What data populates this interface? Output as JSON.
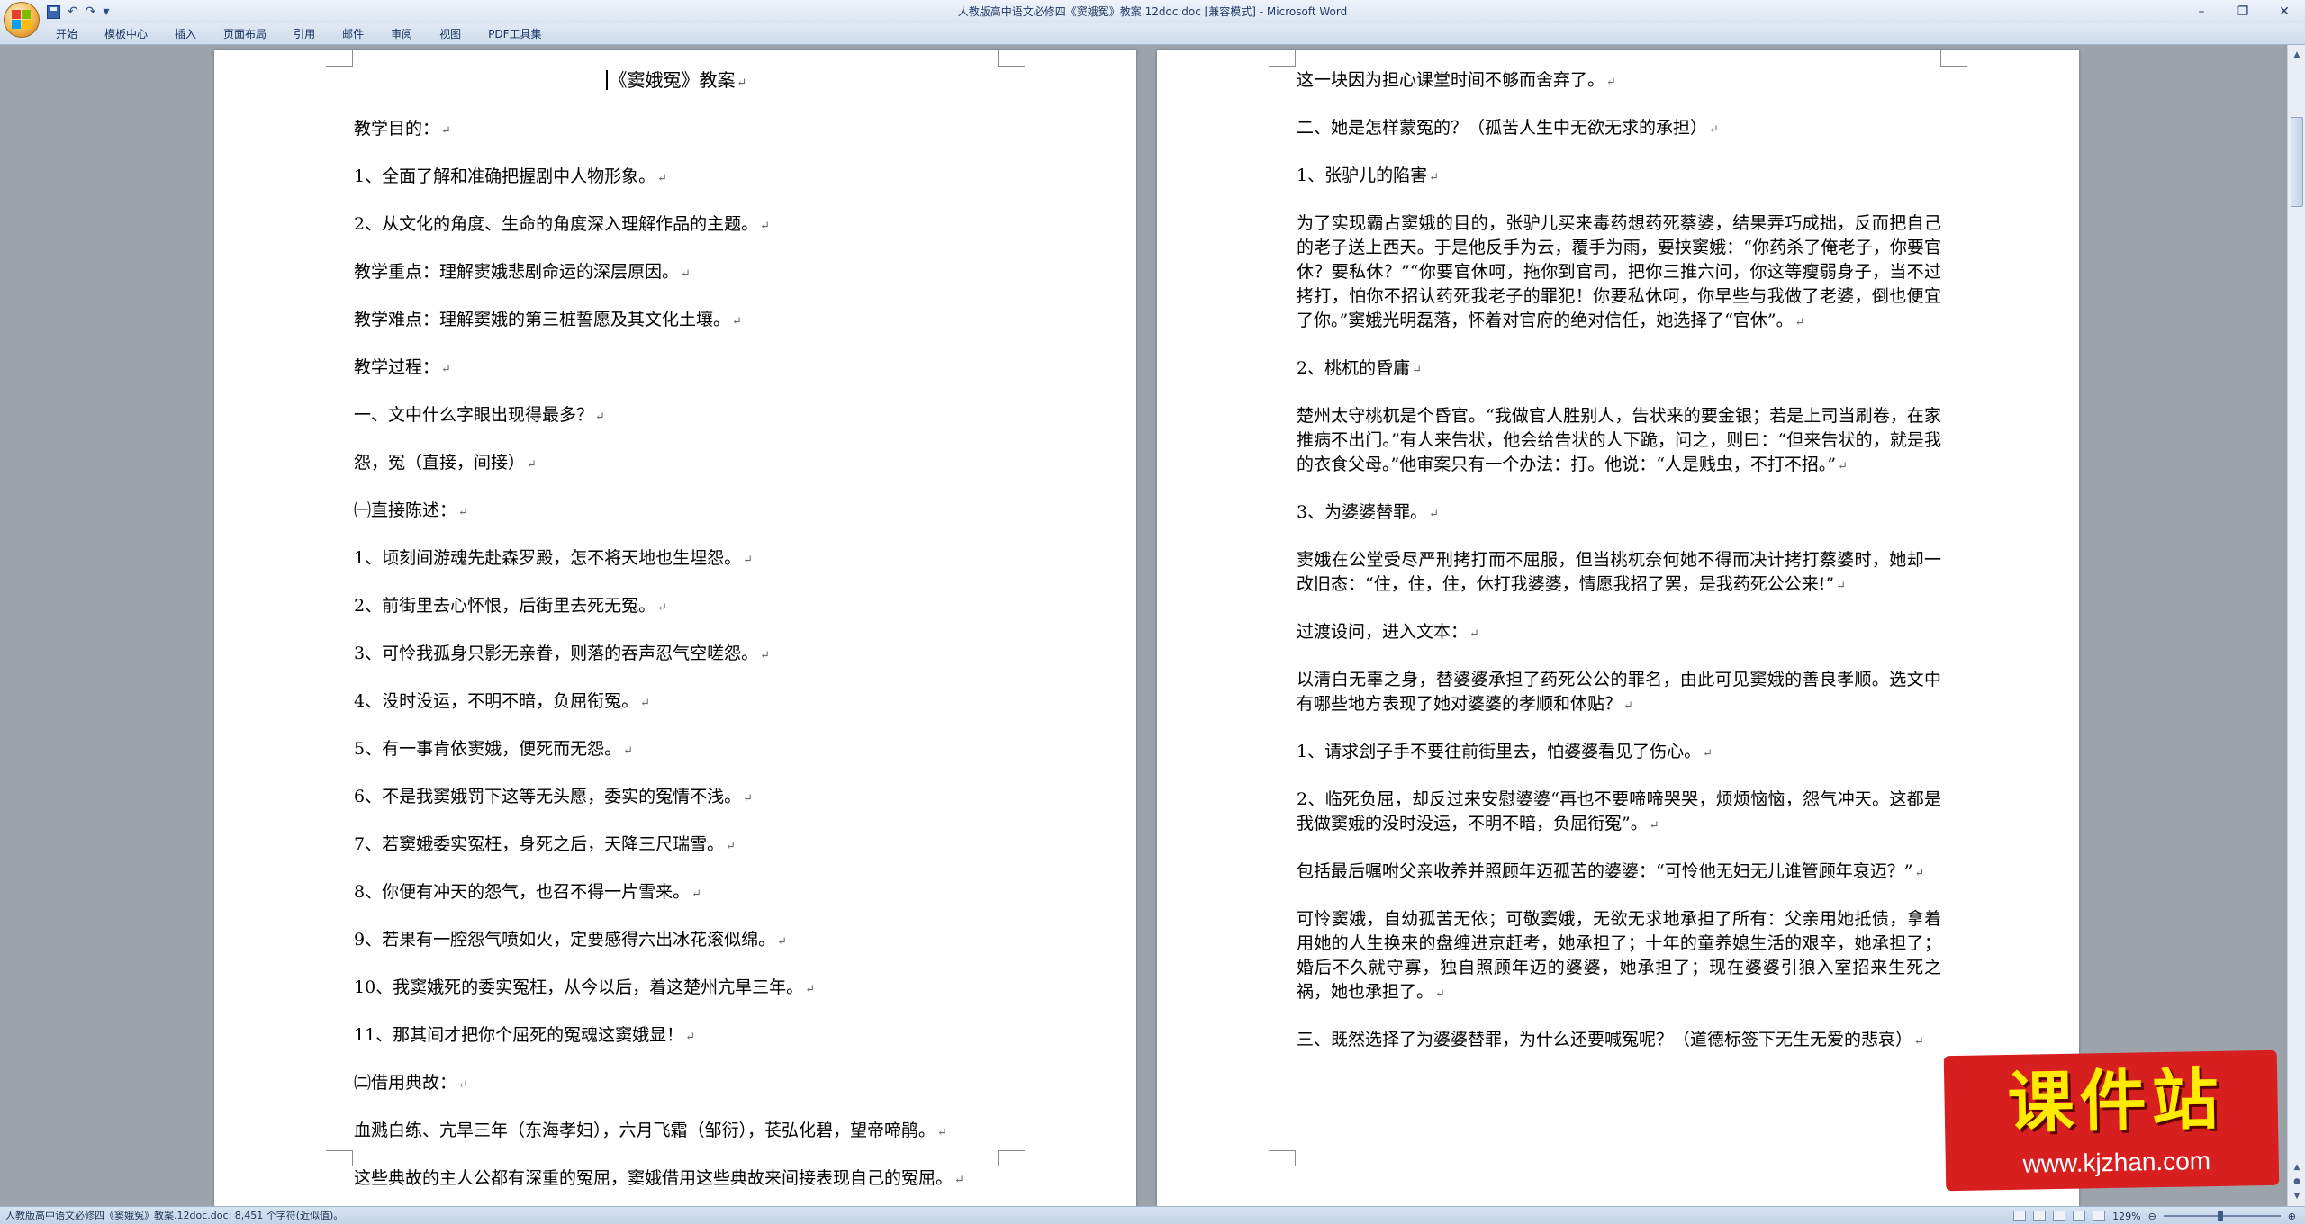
{
  "window": {
    "title": "人教版高中语文必修四《窦娥冤》教案.12doc.doc [兼容模式] - Microsoft Word",
    "minimize": "–",
    "restore": "❐",
    "close": "✕"
  },
  "qat": {
    "undo": "↶",
    "redo": "↷",
    "more": "▾"
  },
  "tabs": [
    "开始",
    "模板中心",
    "插入",
    "页面布局",
    "引用",
    "邮件",
    "审阅",
    "视图",
    "PDF工具集"
  ],
  "document": {
    "title": "《窦娥冤》教案",
    "left_paragraphs": [
      "教学目的：",
      "1、全面了解和准确把握剧中人物形象。",
      "2、从文化的角度、生命的角度深入理解作品的主题。",
      "教学重点：理解窦娥悲剧命运的深层原因。",
      "教学难点：理解窦娥的第三桩誓愿及其文化土壤。",
      "教学过程：",
      "一、文中什么字眼出现得最多？",
      "怨，冤（直接，间接）",
      "㈠直接陈述：",
      "1、顷刻间游魂先赴森罗殿，怎不将天地也生埋怨。",
      "2、前街里去心怀恨，后街里去死无冤。",
      "3、可怜我孤身只影无亲眷，则落的吞声忍气空嗟怨。",
      "4、没时没运，不明不暗，负屈衔冤。",
      "5、有一事肯依窦娥，便死而无怨。",
      "6、不是我窦娥罚下这等无头愿，委实的冤情不浅。",
      "7、若窦娥委实冤枉，身死之后，天降三尺瑞雪。",
      "8、你便有冲天的怨气，也召不得一片雪来。",
      "9、若果有一腔怨气喷如火，定要感得六出冰花滚似绵。",
      "10、我窦娥死的委实冤枉，从今以后，着这楚州亢旱三年。",
      "11、那其间才把你个屈死的冤魂这窦娥显！",
      "㈡借用典故：",
      "血溅白练、亢旱三年（东海孝妇），六月飞霜（邹衍），苌弘化碧，望帝啼鹃。",
      "这些典故的主人公都有深重的冤屈，窦娥借用这些典故来间接表现自己的冤屈。"
    ],
    "right_paragraphs": [
      "这一块因为担心课堂时间不够而舍弃了。",
      "二、她是怎样蒙冤的？（孤苦人生中无欲无求的承担）",
      "1、张驴儿的陷害",
      "为了实现霸占窦娥的目的，张驴儿买来毒药想药死蔡婆，结果弄巧成拙，反而把自己的老子送上西天。于是他反手为云，覆手为雨，要挟窦娥：“你药杀了俺老子，你要官休？要私休？”“你要官休呵，拖你到官司，把你三推六问，你这等瘦弱身子，当不过拷打，怕你不招认药死我老子的罪犯！你要私休呵，你早些与我做了老婆，倒也便宜了你。”窦娥光明磊落，怀着对官府的绝对信任，她选择了“官休”。",
      "2、桃杌的昏庸",
      "楚州太守桃杌是个昏官。“我做官人胜别人，告状来的要金银；若是上司当刷卷，在家推病不出门。”有人来告状，他会给告状的人下跪，问之，则曰：“但来告状的，就是我的衣食父母。”他审案只有一个办法：打。他说：“人是贱虫，不打不招。”",
      "3、为婆婆替罪。",
      "窦娥在公堂受尽严刑拷打而不屈服，但当桃杌奈何她不得而决计拷打蔡婆时，她却一改旧态：“住，住，住，休打我婆婆，情愿我招了罢，是我药死公公来!”",
      "过渡设问，进入文本：",
      "以清白无辜之身，替婆婆承担了药死公公的罪名，由此可见窦娥的善良孝顺。选文中有哪些地方表现了她对婆婆的孝顺和体贴？",
      "1、请求刽子手不要往前街里去，怕婆婆看见了伤心。",
      "2、临死负屈，却反过来安慰婆婆“再也不要啼啼哭哭，烦烦恼恼，怨气冲天。这都是我做窦娥的没时没运，不明不暗，负屈衔冤”。",
      "包括最后嘱咐父亲收养并照顾年迈孤苦的婆婆：“可怜他无妇无儿谁管顾年衰迈？”",
      "可怜窦娥，自幼孤苦无依；可敬窦娥，无欲无求地承担了所有：父亲用她抵债，拿着用她的人生换来的盘缠进京赶考，她承担了；十年的童养媳生活的艰辛，她承担了；婚后不久就守寡，独自照顾年迈的婆婆，她承担了；现在婆婆引狼入室招来生死之祸，她也承担了。",
      "三、既然选择了为婆婆替罪，为什么还要喊冤呢？（道德标签下无生无爱的悲哀）"
    ],
    "paragraph_mark": "↵"
  },
  "status": {
    "text": "人教版高中语文必修四《窦娥冤》教案.12doc.doc: 8,451 个字符(近似值)。",
    "zoom": "129%",
    "zoom_out": "⊖",
    "zoom_in": "⊕"
  },
  "watermark": {
    "title": "课件站",
    "url": "www.kjzhan.com"
  },
  "colors": {
    "watermark_bg": "#d81f1f",
    "watermark_title": "#ffea00"
  }
}
